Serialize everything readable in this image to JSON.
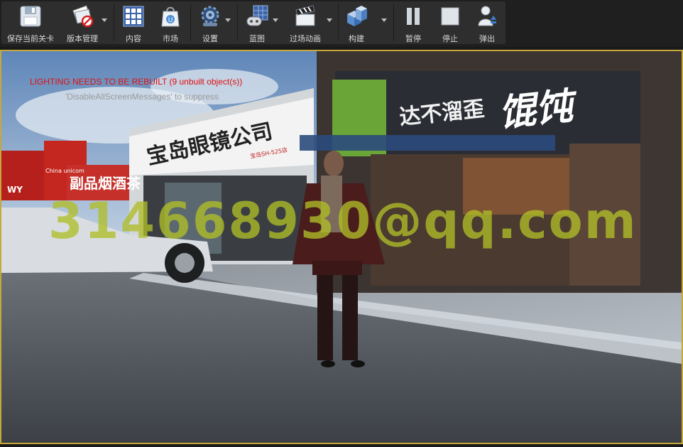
{
  "toolbar": {
    "buttons": [
      {
        "label": "保存当前关卡",
        "icon": "save-icon"
      },
      {
        "label": "版本管理",
        "icon": "source-control-icon"
      },
      {
        "label": "内容",
        "icon": "content-browser-icon"
      },
      {
        "label": "市场",
        "icon": "marketplace-icon"
      },
      {
        "label": "设置",
        "icon": "settings-gear-icon"
      },
      {
        "label": "蓝图",
        "icon": "blueprint-icon"
      },
      {
        "label": "过场动画",
        "icon": "cinematics-clapper-icon"
      },
      {
        "label": "构建",
        "icon": "build-icon"
      },
      {
        "label": "暂停",
        "icon": "pause-icon"
      },
      {
        "label": "停止",
        "icon": "stop-icon"
      },
      {
        "label": "弹出",
        "icon": "eject-icon"
      }
    ]
  },
  "viewport": {
    "warning_message": "LIGHTING NEEDS TO BE REBUILT (9 unbuilt object(s))",
    "suppress_hint": "'DisableAllScreenMessages' to suppress",
    "watermark": "314668930@qq.com",
    "scene": {
      "sign_optical": "宝岛眼镜公司",
      "sign_optical_small": "宝岛SH-525店",
      "sign_wonton_brand": "达不溜歪",
      "sign_wonton_main": "馄饨",
      "sign_liquor": "副品烟酒茶",
      "sign_unicom": "China unicom",
      "sign_wy": "WY"
    }
  },
  "colors": {
    "toolbar_bg": "#2e2e2e",
    "viewport_border": "#c6a83a",
    "warning_red": "#e01010",
    "watermark": "#b0be28"
  }
}
